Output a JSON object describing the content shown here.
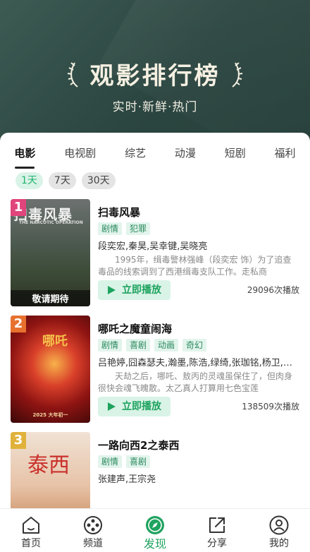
{
  "header": {
    "title": "观影排行榜",
    "subtitle": "实时·新鲜·热门"
  },
  "category_tabs": [
    {
      "label": "电影",
      "active": true
    },
    {
      "label": "电视剧",
      "active": false
    },
    {
      "label": "综艺",
      "active": false
    },
    {
      "label": "动漫",
      "active": false
    },
    {
      "label": "短剧",
      "active": false
    },
    {
      "label": "福利",
      "active": false
    }
  ],
  "time_tabs": [
    {
      "label": "1天",
      "active": true
    },
    {
      "label": "7天",
      "active": false
    },
    {
      "label": "30天",
      "active": false
    }
  ],
  "items": [
    {
      "rank": "1",
      "title": "扫毒风暴",
      "tags": [
        "剧情",
        "犯罪"
      ],
      "cast": "段奕宏,秦昊,吴幸键,吴晓亮",
      "desc": "1995年，缉毒警林强峰（段奕宏 饰）为了追查毒品的线索调到了西港缉毒支队工作。走私商",
      "play_label": "立即播放",
      "plays": "29096次播放",
      "poster_title": "扫毒风暴",
      "poster_sub": "THE NARCOTIC OPERATION",
      "poster_banner": "",
      "poster_bottom": "敬请期待"
    },
    {
      "rank": "2",
      "title": "哪吒之魔童闹海",
      "tags": [
        "剧情",
        "喜剧",
        "动画",
        "奇幻"
      ],
      "cast": "吕艳婷,囧森瑟夫,瀚墨,陈浩,绿绮,张珈铭,杨卫,王...",
      "desc": "天劫之后，哪吒、敖丙的灵魂虽保住了，但肉身很快会魂飞魄散。太乙真人打算用七色宝莲",
      "play_label": "立即播放",
      "plays": "138509次播放",
      "poster_title": "哪吒",
      "poster_date": "2025 大年初一"
    },
    {
      "rank": "3",
      "title": "一路向西2之泰西",
      "tags": [
        "剧情",
        "喜剧"
      ],
      "cast": "张建声,王宗尧",
      "poster_title": "泰西"
    }
  ],
  "bottom_nav": [
    {
      "label": "首页",
      "icon": "home-icon",
      "active": false
    },
    {
      "label": "频道",
      "icon": "film-reel-icon",
      "active": false
    },
    {
      "label": "发现",
      "icon": "compass-icon",
      "active": true
    },
    {
      "label": "分享",
      "icon": "share-icon",
      "active": false
    },
    {
      "label": "我的",
      "icon": "user-icon",
      "active": false
    }
  ],
  "colors": {
    "accent": "#1fa35f",
    "accent_bg": "#d9f3e7",
    "header_bg": "#2f4a44"
  }
}
